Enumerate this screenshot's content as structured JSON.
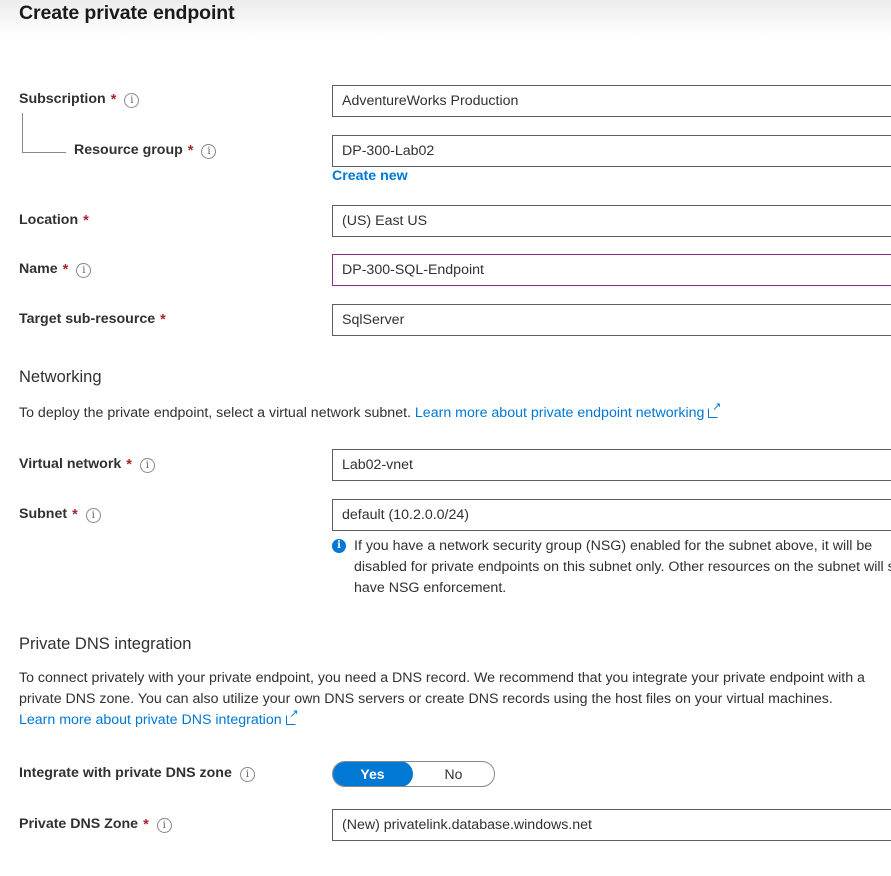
{
  "page": {
    "title": "Create private endpoint"
  },
  "fields": {
    "subscription": {
      "label": "Subscription",
      "required": "*",
      "value": "AdventureWorks Production",
      "info_icon": "info-icon"
    },
    "resource_group": {
      "label": "Resource group",
      "required": "*",
      "value": "DP-300-Lab02",
      "info_icon": "info-icon",
      "create_new_link": "Create new"
    },
    "location": {
      "label": "Location",
      "required": "*",
      "value": "(US) East US"
    },
    "name": {
      "label": "Name",
      "required": "*",
      "value": "DP-300-SQL-Endpoint",
      "info_icon": "info-icon"
    },
    "target_sub_resource": {
      "label": "Target sub-resource",
      "required": "*",
      "value": "SqlServer"
    },
    "virtual_network": {
      "label": "Virtual network",
      "required": "*",
      "value": "Lab02-vnet",
      "info_icon": "info-icon"
    },
    "subnet": {
      "label": "Subnet",
      "required": "*",
      "value": "default (10.2.0.0/24)",
      "info_icon": "info-icon"
    },
    "private_dns_zone": {
      "label": "Private DNS Zone",
      "required": "*",
      "value": "(New) privatelink.database.windows.net",
      "info_icon": "info-icon"
    }
  },
  "networking": {
    "heading": "Networking",
    "description": "To deploy the private endpoint, select a virtual network subnet.",
    "link": "Learn more about private endpoint networking",
    "link_icon": "external-link-icon",
    "nsg_message": {
      "icon": "info-filled-icon",
      "line1": "If you have a network security group (NSG) enabled for the subnet above, it will be",
      "line2": "disabled for private endpoints on this subnet only. Other resources on the subnet will still",
      "line3": "have NSG enforcement."
    }
  },
  "private_dns": {
    "heading": "Private DNS integration",
    "paragraph_line1": "To connect privately with your private endpoint, you need a DNS record. We recommend that you integrate your private endpoint with a",
    "paragraph_line2": "private DNS zone. You can also utilize your own DNS servers or create DNS records using the host files on your virtual machines.",
    "link": "Learn more about private DNS integration",
    "link_icon": "external-link-icon",
    "integrate_toggle": {
      "label": "Integrate with private DNS zone",
      "info_icon": "info-icon",
      "yes_label": "Yes",
      "no_label": "No",
      "selected": "Yes"
    }
  },
  "colors": {
    "accent": "#0078d4",
    "required_asterisk": "#a4262c",
    "focused_border": "#8b2a8b",
    "text": "#323130",
    "border": "#605e5c"
  }
}
